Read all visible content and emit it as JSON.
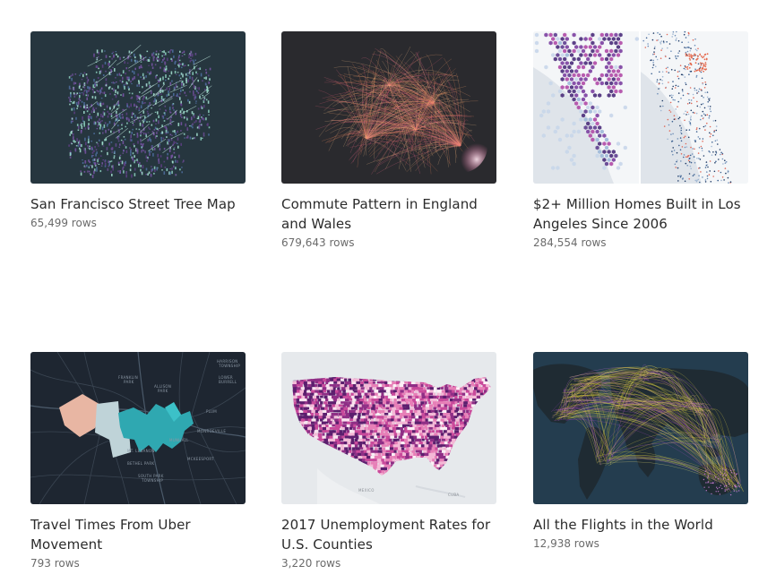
{
  "cards": [
    {
      "title": "San Francisco Street Tree Map",
      "rows": "65,499 rows"
    },
    {
      "title": "Commute Pattern in England and Wales",
      "rows": "679,643 rows"
    },
    {
      "title": "$2+ Million Homes Built in Los Angeles Since 2006",
      "rows": "284,554 rows"
    },
    {
      "title": "Travel Times From Uber Movement",
      "rows": "793 rows"
    },
    {
      "title": "2017 Unemployment Rates for U.S. Counties",
      "rows": "3,220 rows"
    },
    {
      "title": "All the Flights in the World",
      "rows": "12,938 rows"
    }
  ],
  "map_labels": {
    "uber": [
      "HARRISON",
      "TOWNSHIP",
      "FRANKLIN",
      "PARK",
      "ALLISON",
      "PARK",
      "LOWER",
      "BURRELL",
      "PLUM",
      "MONROEVILLE",
      "MUNHALL",
      "MT. LEBANON",
      "BETHEL PARK",
      "MCKEESPORT",
      "SOUTH PARK",
      "TOWNSHIP"
    ],
    "us": [
      "MEXICO",
      "CUBA"
    ]
  },
  "colors": {
    "tree_bg": "#26363f",
    "commute_bg": "#2a2a2e",
    "la_bg": "#eef1f4",
    "uber_bg": "#1e2631",
    "us_bg": "#e6e9ec",
    "flights_bg": "#243d4f"
  }
}
